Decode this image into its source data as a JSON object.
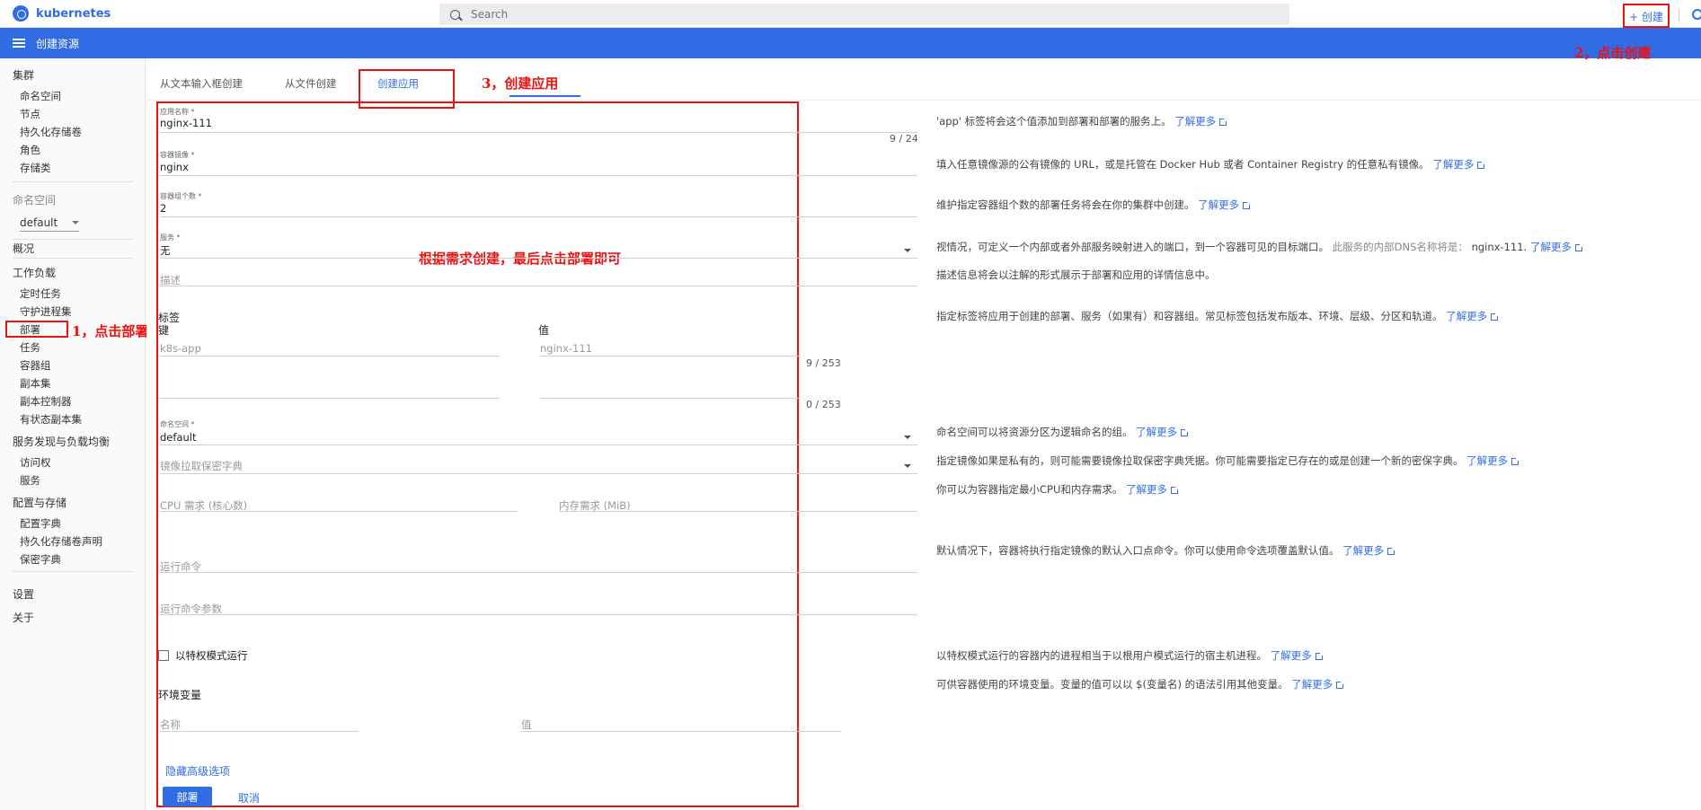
{
  "header": {
    "logo_text": "kubernetes",
    "search_placeholder": "Search",
    "create_label": "+ 创建"
  },
  "titlebar": {
    "title": "创建资源"
  },
  "sidebar": {
    "cluster": "集群",
    "cluster_items": [
      "命名空间",
      "节点",
      "持久化存储卷",
      "角色",
      "存储类"
    ],
    "namespace_label": "命名空间",
    "namespace_value": "default",
    "overview": "概况",
    "workloads": "工作负载",
    "workload_items": [
      "定时任务",
      "守护进程集",
      "部署",
      "任务",
      "容器组",
      "副本集",
      "副本控制器",
      "有状态副本集"
    ],
    "discovery": "服务发现与负载均衡",
    "discovery_items": [
      "访问权",
      "服务"
    ],
    "config": "配置与存储",
    "config_items": [
      "配置字典",
      "持久化存储卷声明",
      "保密字典"
    ],
    "settings": "设置",
    "about": "关于"
  },
  "tabs": [
    "从文本输入框创建",
    "从文件创建",
    "创建应用"
  ],
  "annotations": {
    "step1": "1，点击部署",
    "step2": "2，点击创建",
    "step3": "3，创建应用",
    "note": "根据需求创建，最后点击部署即可"
  },
  "form": {
    "app_name_label": "应用名称 *",
    "app_name_value": "nginx-111",
    "app_name_counter": "9 / 24",
    "image_label": "容器镜像 *",
    "image_value": "nginx",
    "pods_label": "容器组个数 *",
    "pods_value": "2",
    "service_label": "服务 *",
    "service_value": "无",
    "description_placeholder": "描述",
    "labels_title": "标签",
    "key_header": "键",
    "value_header": "值",
    "label_key_placeholder": "k8s-app",
    "label_value_placeholder": "nginx-111",
    "label_counter_1": "9 / 253",
    "label_counter_2": "0 / 253",
    "namespace_label": "命名空间 *",
    "namespace_value": "default",
    "image_pull_secret_placeholder": "镜像拉取保密字典",
    "cpu_placeholder": "CPU 需求 (核心数)",
    "memory_placeholder": "内存需求 (MiB)",
    "run_command_placeholder": "运行命令",
    "run_args_placeholder": "运行命令参数",
    "privileged_label": "以特权模式运行",
    "env_title": "环境变量",
    "env_name_placeholder": "名称",
    "env_value_placeholder": "值",
    "hide_advanced": "隐藏高级选项",
    "deploy": "部署",
    "cancel": "取消"
  },
  "help": {
    "learn_more": "了解更多",
    "app_name": "'app' 标签将会这个值添加到部署和部署的服务上。",
    "image": "填入任意镜像源的公有镜像的 URL，或是托管在 Docker Hub 或者 Container Registry 的任意私有镜像。",
    "pods": "维护指定容器组个数的部署任务将会在你的集群中创建。",
    "service_prefix": "视情况，可定义一个内部或者外部服务映射进入的端口，到一个容器可见的目标端口。",
    "service_suffix": "此服务的内部DNS名称将是：",
    "service_dns": "nginx-111.",
    "description": "描述信息将会以注解的形式展示于部署和应用的详情信息中。",
    "labels": "指定标签将应用于创建的部署、服务（如果有）和容器组。常见标签包括发布版本、环境、层级、分区和轨道。",
    "namespace": "命名空间可以将资源分区为逻辑命名的组。",
    "image_pull_secret": "指定镜像如果是私有的，则可能需要镜像拉取保密字典凭据。你可能需要指定已存在的或是创建一个新的密保字典。",
    "resources": "你可以为容器指定最小CPU和内存需求。",
    "run_command": "默认情况下，容器将执行指定镜像的默认入口点命令。你可以使用命令选项覆盖默认值。",
    "privileged": "以特权模式运行的容器内的进程相当于以根用户模式运行的宿主机进程。",
    "env": "可供容器使用的环境变量。变量的值可以以 $(变量名) 的语法引用其他变量。"
  }
}
